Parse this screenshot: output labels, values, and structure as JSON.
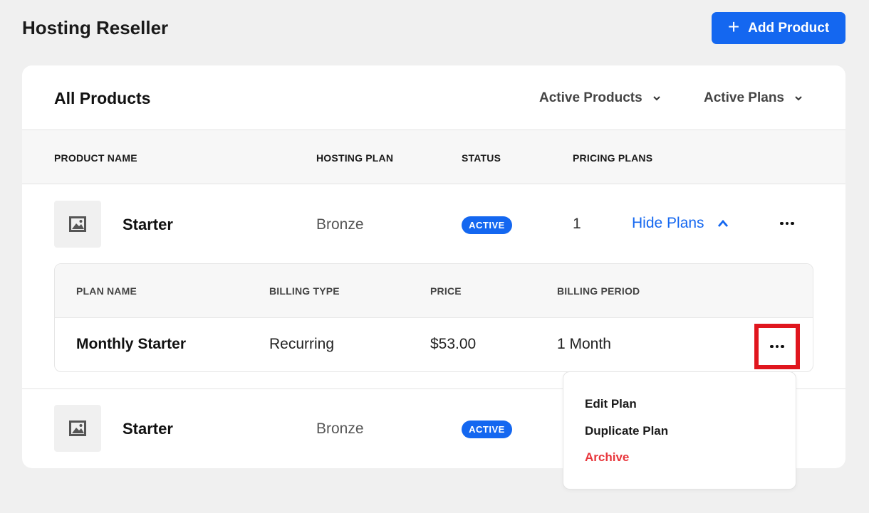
{
  "header": {
    "title": "Hosting Reseller",
    "add_button": "Add Product"
  },
  "card": {
    "title": "All Products",
    "filters": {
      "products": "Active Products",
      "plans": "Active Plans"
    }
  },
  "table": {
    "columns": [
      "PRODUCT NAME",
      "HOSTING PLAN",
      "STATUS",
      "PRICING PLANS"
    ],
    "rows": [
      {
        "name": "Starter",
        "hosting_plan": "Bronze",
        "status": "ACTIVE",
        "pricing_plans": "1",
        "toggle": "Hide Plans"
      },
      {
        "name": "Starter",
        "hosting_plan": "Bronze",
        "status": "ACTIVE"
      }
    ]
  },
  "plans": {
    "columns": [
      "PLAN NAME",
      "BILLING TYPE",
      "PRICE",
      "BILLING PERIOD"
    ],
    "rows": [
      {
        "name": "Monthly Starter",
        "billing_type": "Recurring",
        "price": "$53.00",
        "period": "1 Month"
      }
    ]
  },
  "menu": {
    "items": [
      "Edit Plan",
      "Duplicate Plan",
      "Archive"
    ]
  },
  "colors": {
    "accent": "#1467f0",
    "danger": "#e8363c",
    "highlight": "#e0161e"
  },
  "icons": [
    "plus-icon",
    "chevron-down-icon",
    "chevron-up-icon",
    "image-placeholder-icon",
    "more-horizontal-icon"
  ]
}
